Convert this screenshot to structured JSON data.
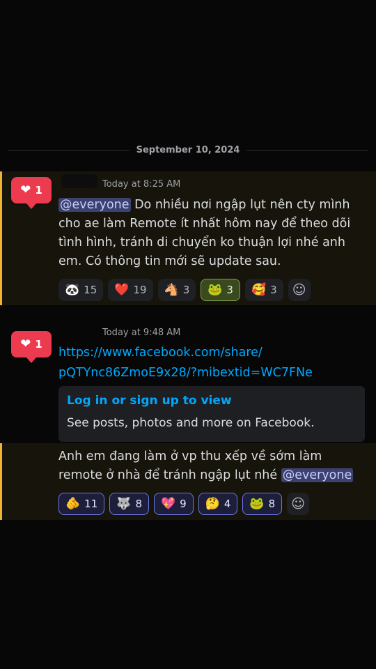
{
  "date_divider": "September 10, 2024",
  "messages": [
    {
      "like_count": "1",
      "timestamp": "Today at 8:25 AM",
      "mention": "@everyone",
      "text": " Do nhiều nơi ngập lụt nên cty mình cho ae làm Remote ít nhất hôm nay để theo dõi tình hình, tránh di chuyển ko thuận lợi nhé anh em. Có thông tin mới sẽ update sau.",
      "reactions": [
        {
          "emoji": "🐼",
          "icon": "panda-emoji-icon",
          "count": "15"
        },
        {
          "emoji": "❤️",
          "icon": "red-heart-emoji-icon",
          "count": "19"
        },
        {
          "emoji": "🐴",
          "icon": "horse-emoji-icon",
          "count": "3"
        },
        {
          "emoji": "🐸",
          "icon": "pepe-frog-emoji-icon",
          "count": "3"
        },
        {
          "emoji": "🥰",
          "icon": "smiling-face-with-hearts-icon",
          "count": "3"
        }
      ]
    },
    {
      "like_count": "1",
      "timestamp": "Today at 9:48 AM",
      "link_line1": "https://www.facebook.com/share/",
      "link_line2": "pQTYnc86ZmoE9x28/?mibextid=WC7FNe",
      "embed_title": "Log in or sign up to view",
      "embed_desc": "See posts, photos and more on Facebook.",
      "followup_text": "Anh em đang làm ở vp thu xếp về sớm làm remote ở nhà để tránh ngập lụt nhé ",
      "followup_mention": "@everyone",
      "reactions": [
        {
          "emoji": "🫵",
          "icon": "pointing-hand-emoji-icon",
          "count": "11"
        },
        {
          "emoji": "🐺",
          "icon": "wolf-emoji-icon",
          "count": "8"
        },
        {
          "emoji": "💖",
          "icon": "sparkling-heart-emoji-icon",
          "count": "9"
        },
        {
          "emoji": "🤔",
          "icon": "thinking-face-emoji-icon",
          "count": "4"
        },
        {
          "emoji": "🐸",
          "icon": "pepe-frog-emoji-icon",
          "count": "8"
        }
      ]
    }
  ],
  "colors": {
    "background": "#070707",
    "mention_highlight": "#16140b",
    "mention_border": "#f0b232",
    "link": "#00a8fc",
    "like_badge": "#ec3a4f"
  }
}
